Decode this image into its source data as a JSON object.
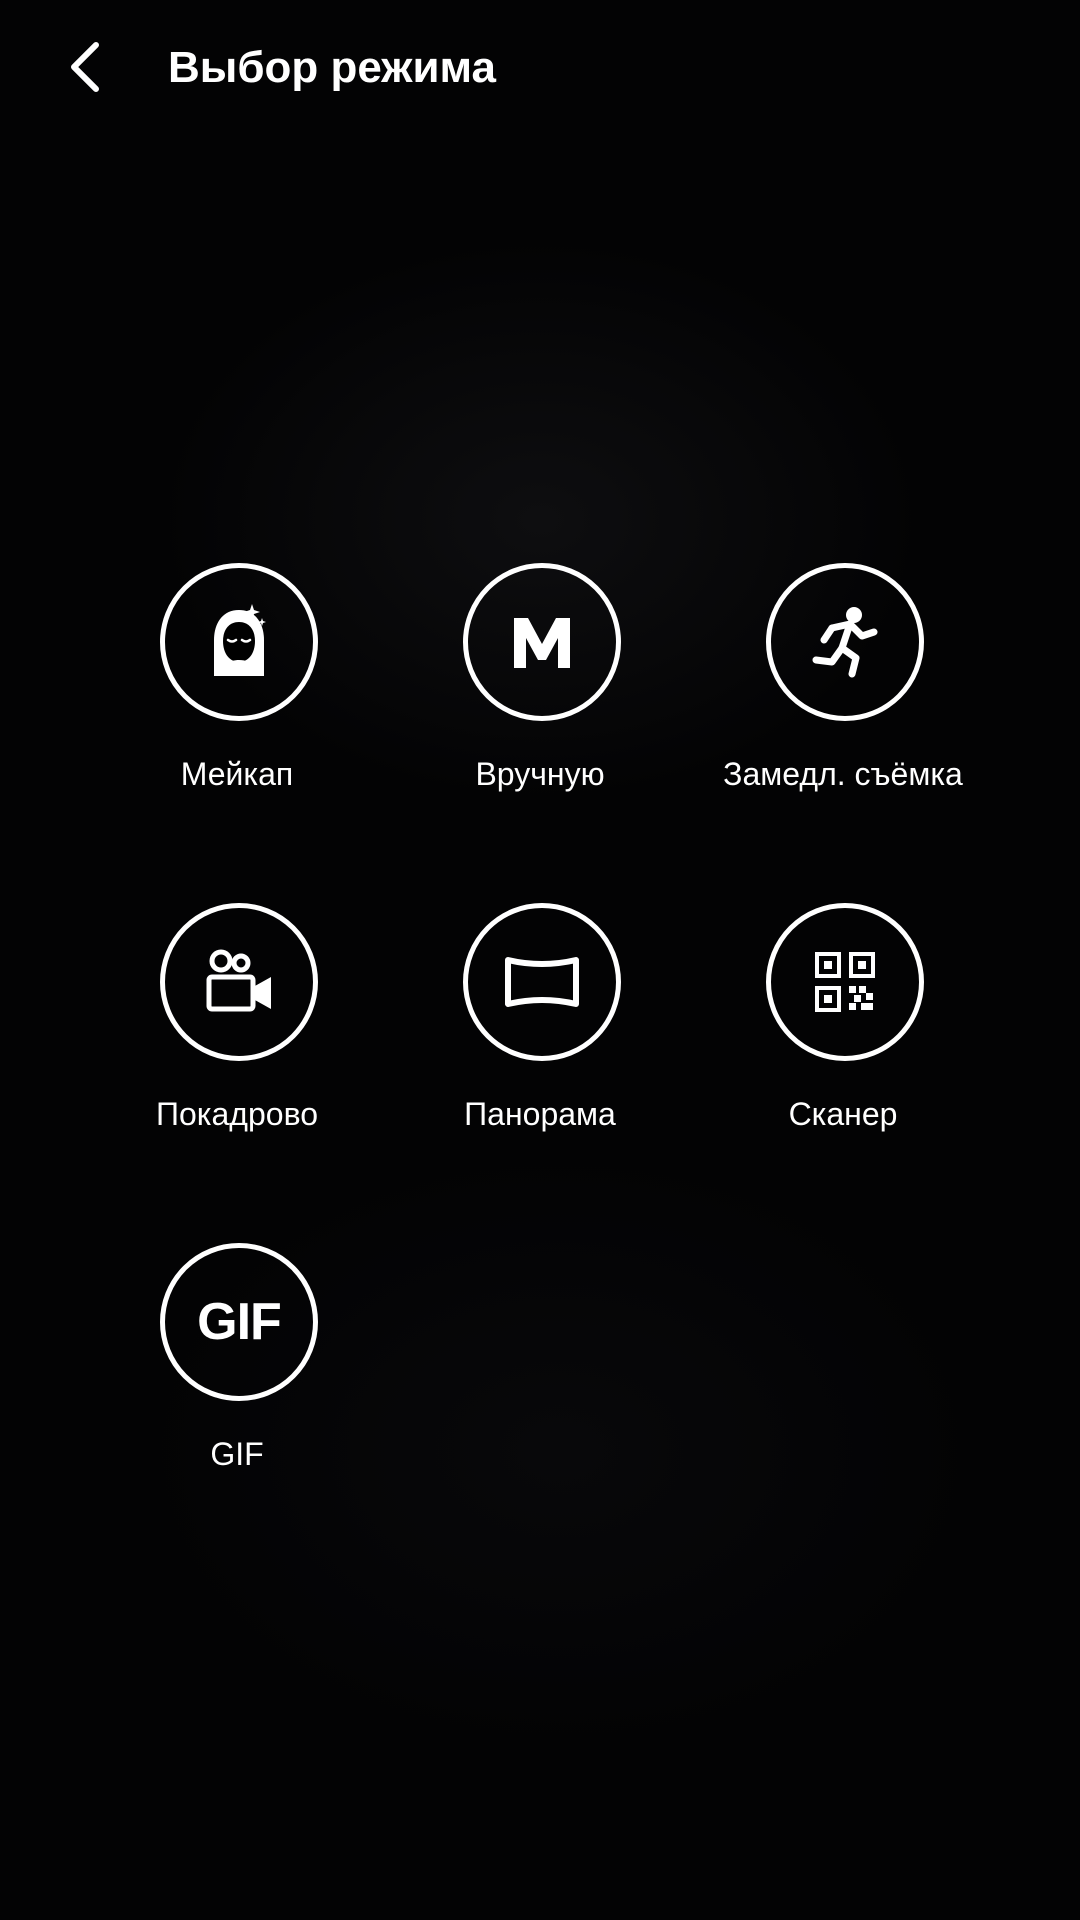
{
  "header": {
    "title": "Выбор режима",
    "back_icon": "chevron-left-icon"
  },
  "modes": [
    {
      "label": "Мейкап",
      "icon": "face-makeup-icon"
    },
    {
      "label": "Вручную",
      "icon": "manual-m-icon"
    },
    {
      "label": "Замедл. съёмка",
      "icon": "running-person-icon"
    },
    {
      "label": "Покадрово",
      "icon": "movie-camera-icon"
    },
    {
      "label": "Панорама",
      "icon": "panorama-icon"
    },
    {
      "label": "Сканер",
      "icon": "qr-code-icon"
    },
    {
      "label": "GIF",
      "icon": "gif-icon",
      "icon_text": "GIF"
    }
  ],
  "colors": {
    "background": "#030304",
    "foreground": "#ffffff"
  }
}
